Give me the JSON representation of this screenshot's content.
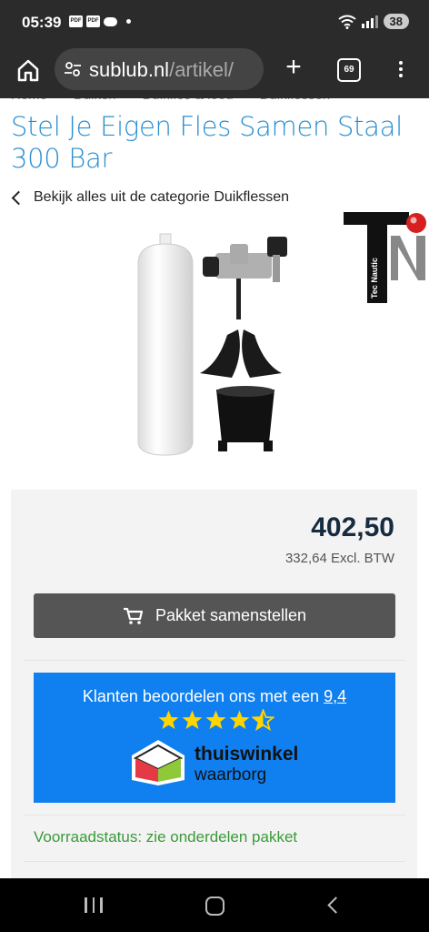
{
  "status_bar": {
    "time": "05:39",
    "notif_label_1": "PDF",
    "notif_label_2": "PDF",
    "battery": "38"
  },
  "browser": {
    "url_host": "sublub.nl",
    "url_path": "/artikel/",
    "tab_count": "69"
  },
  "breadcrumb": [
    "Home",
    "Duiken",
    "Duikfles & lood",
    "Duikflessen"
  ],
  "product": {
    "title": "Stel Je Eigen Fles Samen Staal 300 Bar",
    "back_link": "Bekijk alles uit de categorie Duikflessen",
    "brand_logo_text": "Tec Nautic",
    "price": "402,50",
    "price_ex_vat": "332,64 Excl. BTW",
    "build_button": "Pakket samenstellen"
  },
  "rating": {
    "text_prefix": "Klanten beoordelen ons met een ",
    "score": "9,4",
    "stars": 4.5,
    "logo_line1": "thuiswinkel",
    "logo_line2": "waarborg"
  },
  "stock_status": "Voorraadstatus: zie onderdelen pakket",
  "colors": {
    "title": "#2a8ecf",
    "button": "#555555",
    "rating_bg": "#1080f0",
    "stock": "#3a9a3a",
    "price": "#162b3f"
  }
}
